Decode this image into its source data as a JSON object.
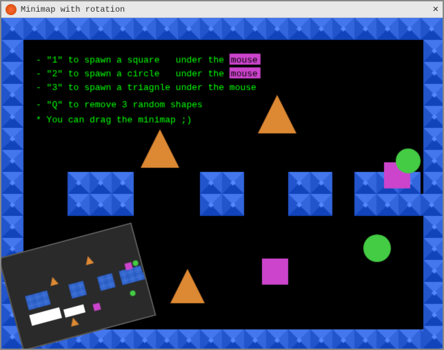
{
  "window": {
    "title": "Minimap with rotation",
    "close_label": "✕"
  },
  "instructions": {
    "line1_prefix": "- \"1\" to spawn a square   under the mouse",
    "line2_prefix": "- \"2\" to spawn a circle   under the mouse",
    "line3_prefix": "- \"3\" to spawn a triagnle under the mouse",
    "line4": "- \"Q\" to remove 3 random shapes",
    "line5": "* You can drag the minimap ;)"
  },
  "colors": {
    "border_tile": "#2255cc",
    "border_tile_light": "#5577ff",
    "border_tile_dark": "#112299",
    "floor_tile": "#3366dd",
    "triangle_orange": "#dd8833",
    "square_purple": "#cc44cc",
    "circle_green": "#44cc44",
    "background": "#000000",
    "text_green": "#00ff00",
    "text_highlight": "#cc44cc"
  }
}
